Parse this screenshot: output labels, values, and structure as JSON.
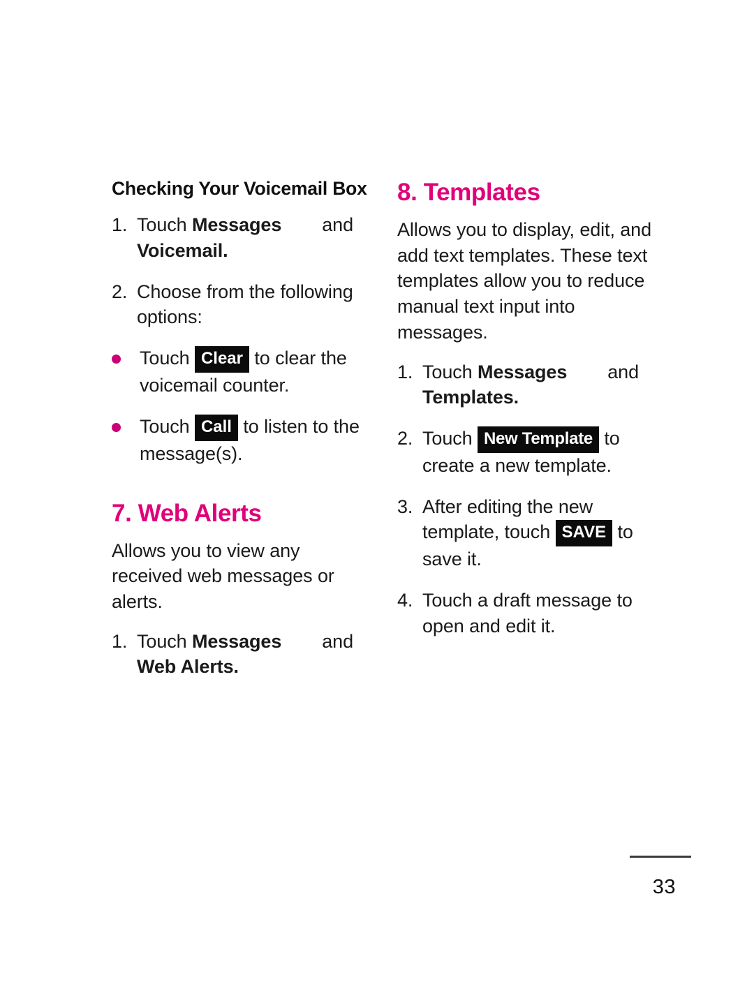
{
  "page": {
    "number": "33"
  },
  "left_column": {
    "sub_heading": "Checking Your Voicemail Box",
    "steps": [
      {
        "marker": "1.",
        "pre": "Touch ",
        "bold1": "Messages",
        "mid": "and",
        "bold2": "Voicemail",
        "post": "."
      },
      {
        "marker": "2.",
        "text": "Choose from the following options:"
      }
    ],
    "bullets": [
      {
        "pre": "Touch ",
        "keycap": "Clear",
        "post": " to clear the voicemail counter."
      },
      {
        "pre": "Touch ",
        "keycap": "Call",
        "post": " to listen to the message(s)."
      }
    ],
    "section": {
      "heading": "7. Web Alerts",
      "paragraph": "Allows you to view any received web messages or alerts.",
      "steps": [
        {
          "marker": "1.",
          "pre": "Touch ",
          "bold1": "Messages",
          "mid": "and",
          "bold2": "Web Alerts",
          "post": "."
        }
      ]
    }
  },
  "right_column": {
    "section": {
      "heading": "8. Templates",
      "paragraph": "Allows you to display, edit, and add text templates. These text templates allow you to reduce manual text input into messages."
    },
    "steps": [
      {
        "marker": "1.",
        "pre": "Touch ",
        "bold1": "Messages",
        "mid": "and",
        "bold2": "Templates",
        "post": "."
      },
      {
        "marker": "2.",
        "pre": "Touch ",
        "keycap": "New Template",
        "post": " to create a new template."
      },
      {
        "marker": "3.",
        "pre": "After editing the new template, touch ",
        "keycap": "SAVE",
        "post": " to save it."
      },
      {
        "marker": "4.",
        "text": "Touch a draft message to open and edit it."
      }
    ]
  },
  "colors": {
    "accent_magenta": "#e0007a",
    "bullet_magenta": "#cc0077",
    "keycap_background": "#0b0b0b",
    "text": "#1a1a1a"
  }
}
